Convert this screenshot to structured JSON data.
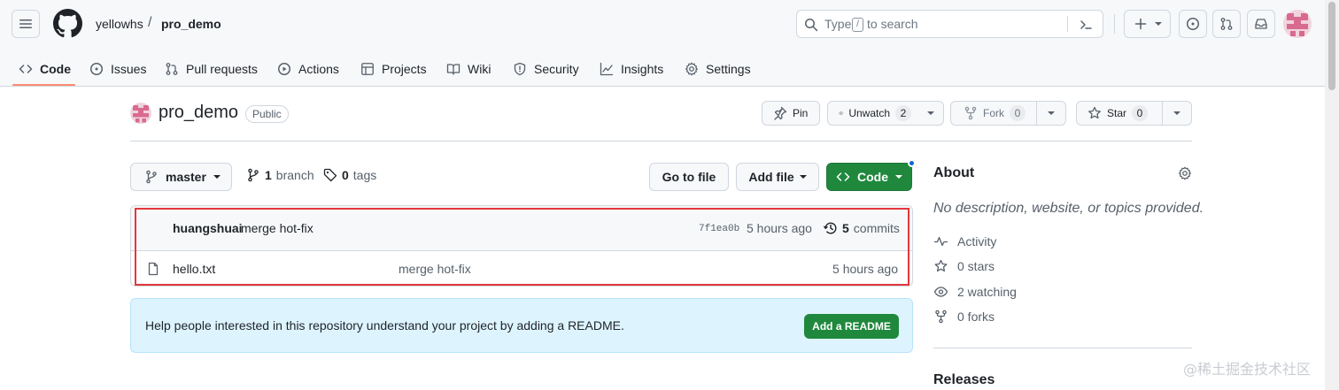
{
  "header": {
    "owner": "yellowhs",
    "separator": "/",
    "repo": "pro_demo",
    "search": {
      "prefix": "Type",
      "key": "/",
      "suffix": "to search"
    }
  },
  "nav": {
    "tabs": [
      {
        "label": "Code",
        "icon": "code-icon",
        "active": true
      },
      {
        "label": "Issues",
        "icon": "issue-icon"
      },
      {
        "label": "Pull requests",
        "icon": "pull-request-icon"
      },
      {
        "label": "Actions",
        "icon": "play-icon"
      },
      {
        "label": "Projects",
        "icon": "table-icon"
      },
      {
        "label": "Wiki",
        "icon": "book-icon"
      },
      {
        "label": "Security",
        "icon": "shield-icon"
      },
      {
        "label": "Insights",
        "icon": "graph-icon"
      },
      {
        "label": "Settings",
        "icon": "gear-icon"
      }
    ]
  },
  "repo": {
    "name": "pro_demo",
    "visibility": "Public",
    "pin_label": "Pin",
    "watch_label": "Unwatch",
    "watch_count": "2",
    "fork_label": "Fork",
    "fork_count": "0",
    "star_label": "Star",
    "star_count": "0"
  },
  "toolbar": {
    "branch": "master",
    "branch_count": "1",
    "branch_label": "branch",
    "tag_count": "0",
    "tag_label": "tags",
    "go_to_file": "Go to file",
    "add_file": "Add file",
    "code": "Code"
  },
  "latest_commit": {
    "author": "huangshuai",
    "message": "merge hot-fix",
    "sha": "7f1ea0b",
    "time": "5 hours ago",
    "commit_count": "5",
    "commit_label": "commits"
  },
  "files": [
    {
      "name": "hello.txt",
      "message": "merge hot-fix",
      "time": "5 hours ago"
    }
  ],
  "readme_banner": {
    "text": "Help people interested in this repository understand your project by adding a README.",
    "button": "Add a README"
  },
  "about": {
    "title": "About",
    "description": "No description, website, or topics provided.",
    "activity": "Activity",
    "stars": "0 stars",
    "watching": "2 watching",
    "forks": "0 forks",
    "releases": "Releases"
  },
  "watermark": "@稀土掘金技术社区",
  "colors": {
    "accent_green": "#1f883d",
    "highlight_red": "#e5373c",
    "nav_underline": "#fd8c73",
    "banner_bg": "#ddf4ff"
  }
}
